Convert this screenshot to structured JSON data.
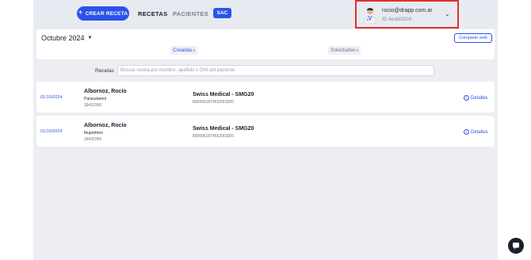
{
  "header": {
    "new_button": {
      "icon": "plus-icon",
      "label": "CREAR RECETA"
    },
    "nav": [
      {
        "label": "RECETAS",
        "active": true
      },
      {
        "label": "PACIENTES",
        "active": false
      }
    ],
    "sac_label": "SAC",
    "user": {
      "avatar": "doctor-avatar-icon",
      "email": "rocio@drapp.com.ar",
      "id": "ID 6edd3509",
      "chevron": "chevron-down-icon"
    }
  },
  "annotation": {
    "arrow_color": "#e0302b",
    "box_color": "#e0302b"
  },
  "filters": {
    "month": "Octubre 2024",
    "share_label": "Compartir web",
    "tabs": [
      {
        "label": "Creadas",
        "count": "2"
      },
      {
        "label": "Solicitudes",
        "count": "0"
      }
    ]
  },
  "search": {
    "label": "Recetas",
    "placeholder": "Buscar receta por nombre, apellido o DNI del paciente"
  },
  "rows": [
    {
      "date": "01/10/2024",
      "patient": "Albornoz, Rocío",
      "drug": "Paracetamol",
      "dni": "39432366",
      "insurer": "Swiss Medical - SMG20",
      "insurer_number": "80000618745520IS005",
      "details": "Detalles"
    },
    {
      "date": "01/10/2024",
      "patient": "Albornoz, Rocío",
      "drug": "Ibuprofeno",
      "dni": "39432366",
      "insurer": "Swiss Medical - SMG20",
      "insurer_number": "80000618745520IS005",
      "details": "Detalles"
    }
  ],
  "colors": {
    "accent": "#2a54e8",
    "background": "#eceef3"
  }
}
